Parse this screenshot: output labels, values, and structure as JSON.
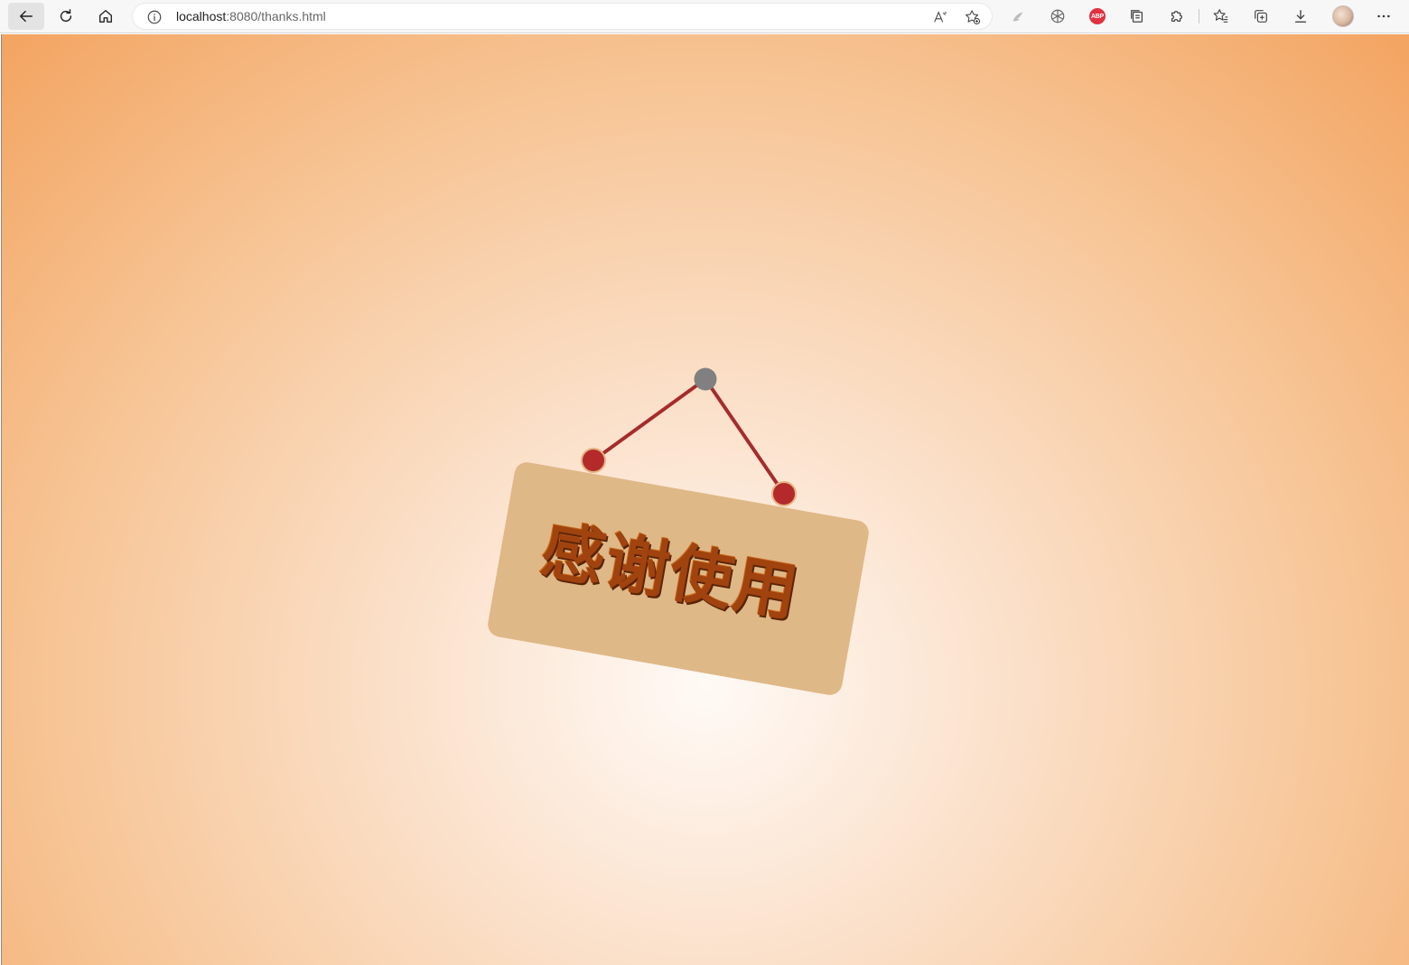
{
  "browser": {
    "url_host": "localhost",
    "url_path": ":8080/thanks.html",
    "icons": {
      "back": "back-arrow-icon",
      "refresh": "refresh-icon",
      "home": "home-icon",
      "info": "info-icon",
      "read_aloud": "read-aloud-icon",
      "add_favorite": "add-favorite-icon",
      "extension_1": "feather-icon",
      "extension_2": "aperture-icon",
      "extension_3": "adblock-plus-icon",
      "extension_4": "copy-icon",
      "extensions": "puzzle-icon",
      "favorites": "favorites-icon",
      "collections": "collections-icon",
      "downloads": "download-icon",
      "more": "more-icon"
    },
    "abp_label": "ABP"
  },
  "sign": {
    "text": "感谢使用",
    "colors": {
      "board": "#dfb887",
      "text": "#a0430e",
      "string": "#a72b2b",
      "pin_red": "#b42a2a",
      "pin_gray": "#808080"
    }
  }
}
